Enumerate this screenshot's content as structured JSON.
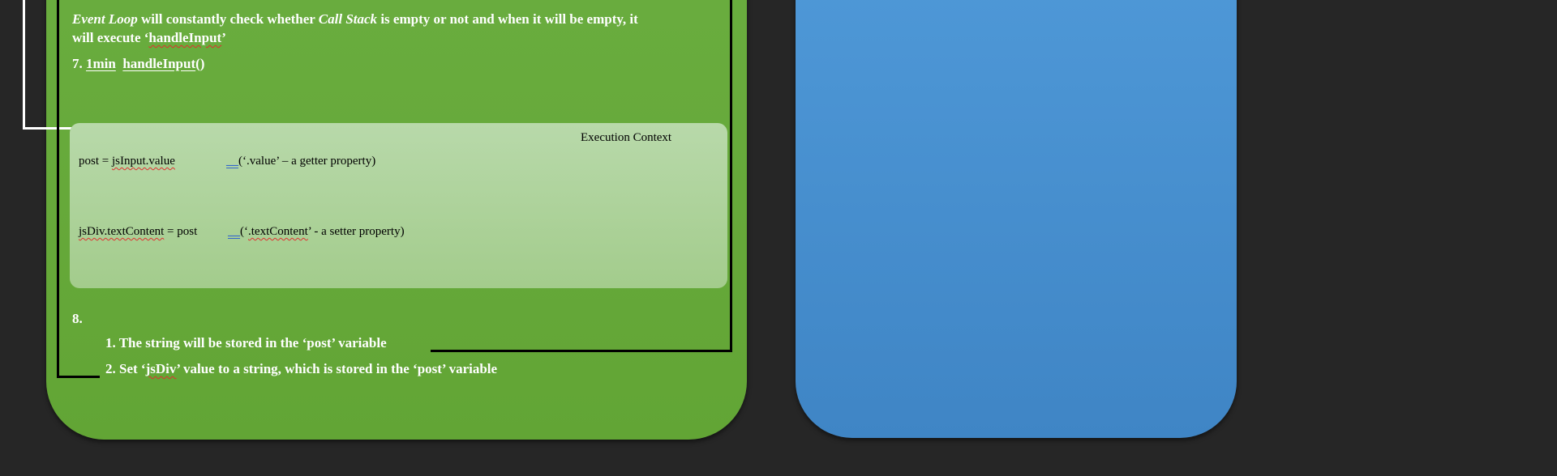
{
  "event_loop": {
    "part1_italic": "Event Loop",
    "part2": " will constantly check whether ",
    "part3_italic": "Call Stack",
    "part4": " is empty or not and when it will be empty, it",
    "line2_prefix": "will execute ‘",
    "line2_fn": "handleInput",
    "line2_suffix": "’"
  },
  "step7": {
    "number": "7. ",
    "time": "1min",
    "fn": "handleInput",
    "parens": "()"
  },
  "execution_context": {
    "title": "Execution Context",
    "row1_lhs": "post = ",
    "row1_obj": "jsInput.value",
    "row1_mark": "__",
    "row1_note": "(‘.value’ – a getter property)",
    "row2_obj": "jsDiv.textContent",
    "row2_rhs": " = post",
    "row2_mark": "__",
    "row2_note_open": "(‘",
    "row2_note_prop": ".textContent",
    "row2_note_rest": "’  - a  setter property)"
  },
  "step8": {
    "number": "8.",
    "item1": "1. The string will be stored in the ‘post’ variable",
    "item2_prefix": "2. Set ‘",
    "item2_var": "jsDiv",
    "item2_suffix": "’ value to a string, which is stored in the ‘post’ variable"
  },
  "colors": {
    "background": "#262626",
    "green_card": "#66aa3a",
    "blue_card": "#4a90d2",
    "execution_context_box": "#afd39c"
  }
}
